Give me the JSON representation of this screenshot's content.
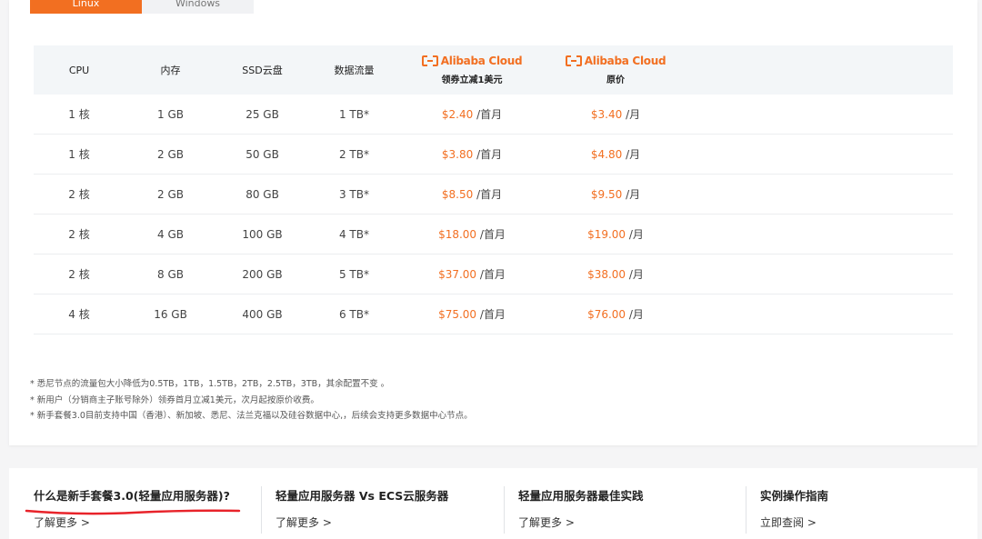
{
  "tabs": [
    {
      "label": "Linux",
      "active": true
    },
    {
      "label": "Windows",
      "active": false
    }
  ],
  "table": {
    "headers": {
      "cpu": "CPU",
      "memory": "内存",
      "ssd": "SSD云盘",
      "traffic": "数据流量"
    },
    "brand": "Alibaba Cloud",
    "brand_color": "#f26f21",
    "promo_header": "领券立减1美元",
    "original_header": "原价",
    "rows": [
      {
        "cpu": "1 核",
        "memory": "1 GB",
        "ssd": "25 GB",
        "traffic": "1 TB*",
        "promo_price": "$2.40",
        "promo_unit": "/首月",
        "orig_price": "$3.40",
        "orig_unit": "/月"
      },
      {
        "cpu": "1 核",
        "memory": "2 GB",
        "ssd": "50 GB",
        "traffic": "2 TB*",
        "promo_price": "$3.80",
        "promo_unit": "/首月",
        "orig_price": "$4.80",
        "orig_unit": "/月"
      },
      {
        "cpu": "2 核",
        "memory": "2 GB",
        "ssd": "80 GB",
        "traffic": "3 TB*",
        "promo_price": "$8.50",
        "promo_unit": "/首月",
        "orig_price": "$9.50",
        "orig_unit": "/月"
      },
      {
        "cpu": "2 核",
        "memory": "4 GB",
        "ssd": "100 GB",
        "traffic": "4 TB*",
        "promo_price": "$18.00",
        "promo_unit": "/首月",
        "orig_price": "$19.00",
        "orig_unit": "/月"
      },
      {
        "cpu": "2 核",
        "memory": "8 GB",
        "ssd": "200 GB",
        "traffic": "5 TB*",
        "promo_price": "$37.00",
        "promo_unit": "/首月",
        "orig_price": "$38.00",
        "orig_unit": "/月"
      },
      {
        "cpu": "4 核",
        "memory": "16 GB",
        "ssd": "400 GB",
        "traffic": "6 TB*",
        "promo_price": "$75.00",
        "promo_unit": "/首月",
        "orig_price": "$76.00",
        "orig_unit": "/月"
      }
    ]
  },
  "notes": [
    "* 悉尼节点的流量包大小降低为0.5TB，1TB，1.5TB，2TB，2.5TB，3TB，其余配置不变 。",
    "* 新用户（分销商主子账号除外）领券首月立减1美元，次月起按原价收费。",
    "* 新手套餐3.0目前支持中国（香港）、新加坡、悉尼、法兰克福以及硅谷数据中心,，后续会支持更多数据中心节点。"
  ],
  "bottom_links": [
    {
      "title": "什么是新手套餐3.0(轻量应用服务器)?",
      "more": "了解更多 >"
    },
    {
      "title": "轻量应用服务器 Vs ECS云服务器",
      "more": "了解更多 >"
    },
    {
      "title": "轻量应用服务器最佳实践",
      "more": "了解更多 >"
    },
    {
      "title": "实例操作指南",
      "more": "立即查阅 >"
    }
  ],
  "annotation_color": "#e8232a"
}
